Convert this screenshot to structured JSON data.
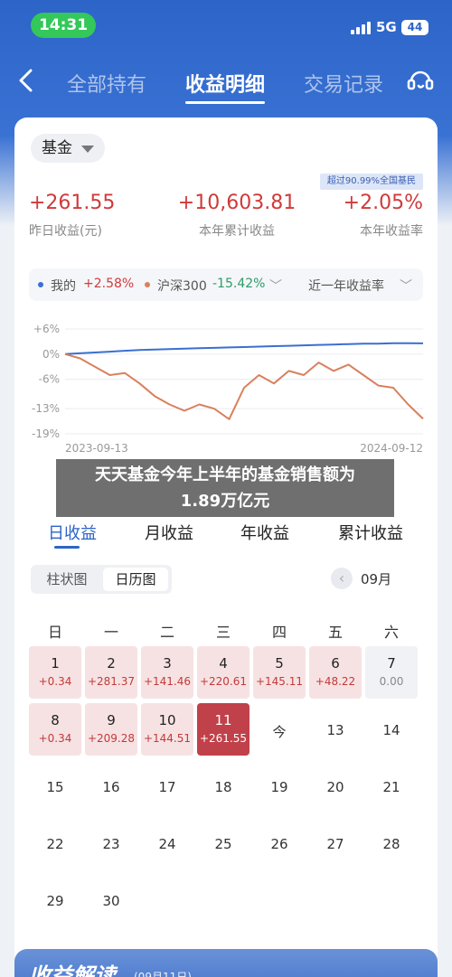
{
  "status_bar": {
    "time": "14:31",
    "network": "5G",
    "battery": "44"
  },
  "nav": {
    "tabs": [
      "全部持有",
      "收益明细",
      "交易记录"
    ],
    "active_tab": 1
  },
  "summary": {
    "fund_selector": "基金",
    "rank_badge": "超过90.99%全国基民",
    "stats": [
      {
        "value": "+261.55",
        "label": "昨日收益(元)"
      },
      {
        "value": "+10,603.81",
        "label": "本年累计收益"
      },
      {
        "value": "+2.05%",
        "label": "本年收益率"
      }
    ]
  },
  "legend": {
    "mine_label": "我的",
    "mine_value": "+2.58%",
    "index_label": "沪深300",
    "index_value": "-15.42%",
    "period": "近一年收益率"
  },
  "colors": {
    "mine": "#3b6fd0",
    "index": "#d9805c",
    "gain": "#d03a3a",
    "accent": "#2c64c8",
    "index_value": "#2f9a6a"
  },
  "chart_data": {
    "type": "line",
    "x_start": "2023-09-13",
    "x_end": "2024-09-12",
    "ytick_labels": [
      "+6%",
      "0%",
      "-6%",
      "-13%",
      "-19%"
    ],
    "ylim": [
      -19,
      6
    ],
    "series": [
      {
        "name": "我的",
        "values": [
          0,
          0.2,
          0.4,
          0.6,
          0.8,
          1.0,
          1.1,
          1.2,
          1.3,
          1.4,
          1.5,
          1.6,
          1.7,
          1.8,
          1.9,
          2.0,
          2.1,
          2.2,
          2.3,
          2.4,
          2.5,
          2.5,
          2.6,
          2.6,
          2.58
        ]
      },
      {
        "name": "沪深300",
        "values": [
          0,
          -1.0,
          -3.0,
          -5.0,
          -4.5,
          -7.0,
          -10.0,
          -12.0,
          -13.5,
          -12.0,
          -13.0,
          -15.5,
          -8.0,
          -5.0,
          -7.0,
          -4.0,
          -5.0,
          -2.0,
          -4.0,
          -2.5,
          -5.0,
          -7.5,
          -8.0,
          -12.0,
          -15.42
        ]
      }
    ]
  },
  "overlay_caption": [
    "天天基金今年上半年的基金销售额为",
    "1.89万亿元"
  ],
  "earnings_tabs": [
    "日收益",
    "月收益",
    "年收益",
    "累计收益"
  ],
  "view_toggle": [
    "柱状图",
    "日历图"
  ],
  "calendar": {
    "month": "09月",
    "weekdays": [
      "日",
      "一",
      "二",
      "三",
      "四",
      "五",
      "六"
    ],
    "gain_days": [
      {
        "day": "1",
        "value": "+0.34"
      },
      {
        "day": "2",
        "value": "+281.37"
      },
      {
        "day": "3",
        "value": "+141.46"
      },
      {
        "day": "4",
        "value": "+220.61"
      },
      {
        "day": "5",
        "value": "+145.11"
      },
      {
        "day": "6",
        "value": "+48.22"
      },
      {
        "day": "7",
        "value": "0.00"
      },
      {
        "day": "8",
        "value": "+0.34"
      },
      {
        "day": "9",
        "value": "+209.28"
      },
      {
        "day": "10",
        "value": "+144.51"
      },
      {
        "day": "11",
        "value": "+261.55"
      }
    ],
    "today_label": "今",
    "plain_days": [
      "13",
      "14",
      "15",
      "16",
      "17",
      "18",
      "19",
      "20",
      "21",
      "22",
      "23",
      "24",
      "25",
      "26",
      "27",
      "28",
      "29",
      "30"
    ]
  },
  "bottom_panel": {
    "title": "收益解读",
    "date": "(09月11日)"
  }
}
